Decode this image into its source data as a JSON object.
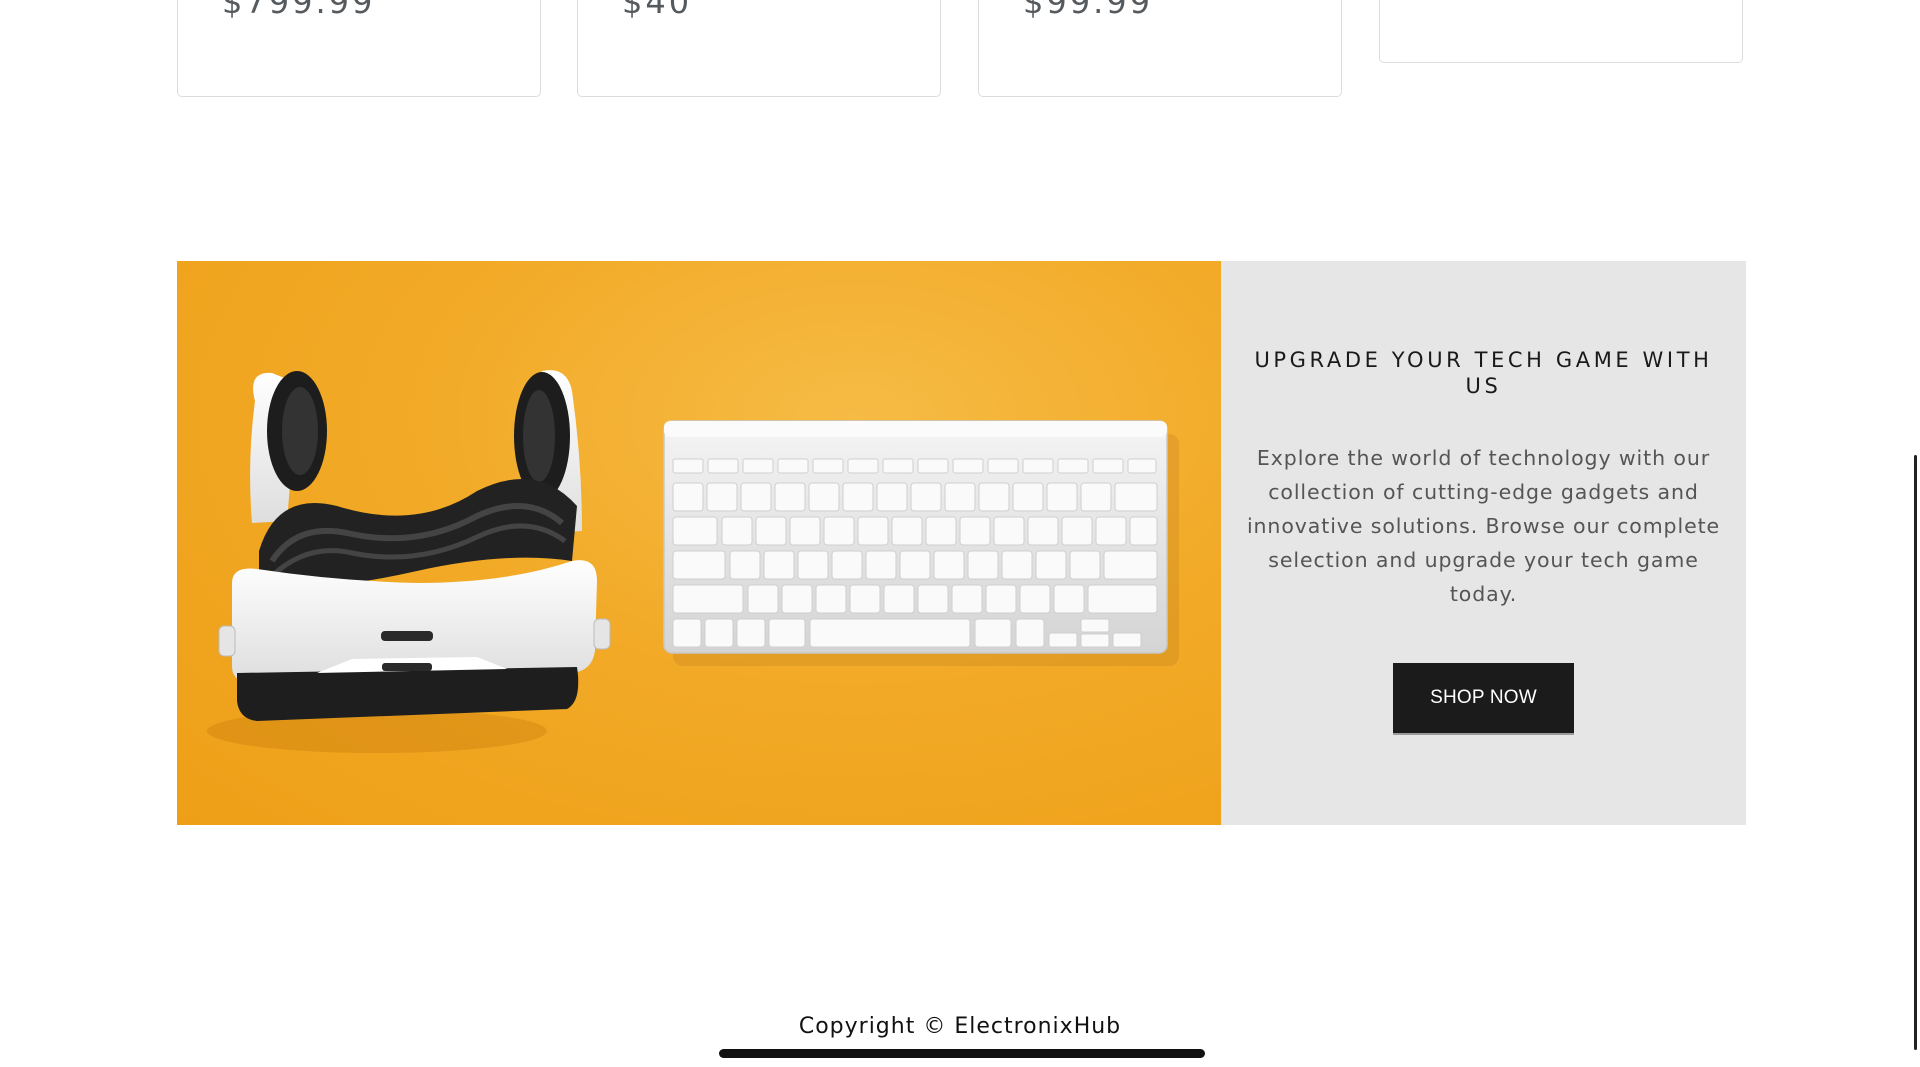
{
  "product_cards": [
    {
      "price": "$799.99"
    },
    {
      "price": "$40"
    },
    {
      "price": "$99.99"
    },
    {
      "price": ""
    }
  ],
  "promo": {
    "heading": "UPGRADE YOUR TECH GAME WITH US",
    "body": "Explore the world of technology with our collection of cutting-edge gadgets and innovative solutions. Browse our complete selection and upgrade your tech game today.",
    "button_label": "SHOP NOW",
    "image_icon": "vr-headset-and-keyboard-image",
    "image_background_color": "#f2aa27",
    "panel_color": "#e6e6e6",
    "button_color": "#1b1b1b"
  },
  "footer": {
    "copyright": "Copyright © ElectronixHub"
  }
}
